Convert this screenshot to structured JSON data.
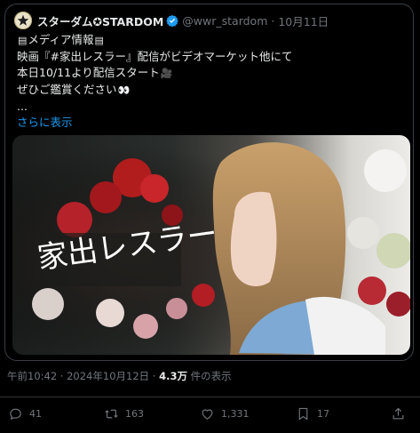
{
  "tweet": {
    "display_name": "スターダム✪STARDOM",
    "handle": "@wwr_stardom",
    "separator": "·",
    "date": "10月11日",
    "lines": [
      "メディア情報",
      "映画『#家出レスラー』配信がビデオマーケット他にて",
      "本日10/11より配信スタート",
      "ぜひご鑑賞ください",
      "..."
    ],
    "show_more": "さらに表示"
  },
  "media": {
    "title": "家出レスラー"
  },
  "meta": {
    "timestamp": "午前10:42 · 2024年10月12日 · ",
    "views_count": "4.3万",
    "views_label": " 件の表示"
  },
  "actions": {
    "replies": "41",
    "retweets": "163",
    "likes": "1,331",
    "bookmarks": "17"
  },
  "colors": {
    "link": "#1d9bf0",
    "secondary_text": "#71767b",
    "verified": "#1d9bf0"
  }
}
